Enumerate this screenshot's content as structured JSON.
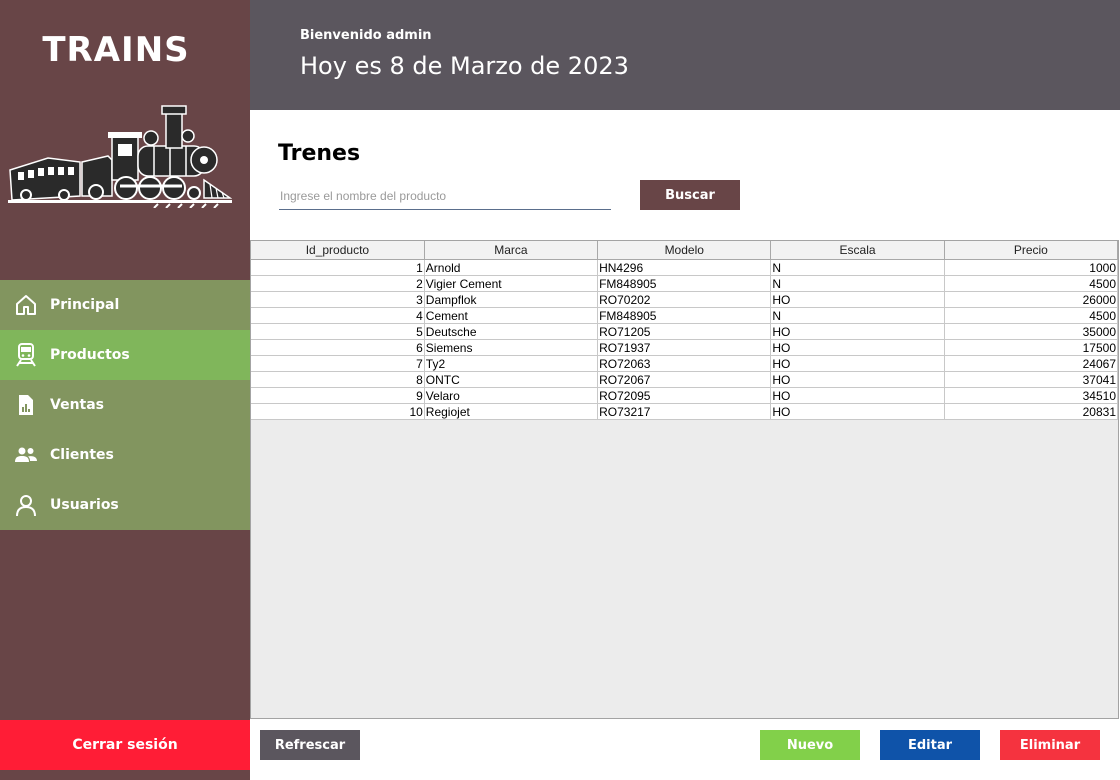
{
  "sidebar": {
    "app_title": "TRAINS",
    "items": [
      {
        "label": "Principal",
        "icon": "home-icon"
      },
      {
        "label": "Productos",
        "icon": "train-icon",
        "active": true
      },
      {
        "label": "Ventas",
        "icon": "report-icon"
      },
      {
        "label": "Clientes",
        "icon": "people-icon"
      },
      {
        "label": "Usuarios",
        "icon": "user-icon"
      }
    ],
    "logout_label": "Cerrar sesión"
  },
  "header": {
    "welcome": "Bienvenido admin",
    "date": "Hoy es 8 de Marzo de 2023"
  },
  "main": {
    "title": "Trenes",
    "search": {
      "placeholder": "Ingrese el nombre del producto",
      "value": "",
      "button_label": "Buscar"
    },
    "table": {
      "columns": [
        "Id_producto",
        "Marca",
        "Modelo",
        "Escala",
        "Precio"
      ],
      "rows": [
        [
          "1",
          "Arnold",
          "HN4296",
          "N",
          "1000"
        ],
        [
          "2",
          "Vigier Cement",
          "FM848905",
          "N",
          "4500"
        ],
        [
          "3",
          "Dampflok",
          "RO70202",
          "HO",
          "26000"
        ],
        [
          "4",
          "Cement",
          "FM848905",
          "N",
          "4500"
        ],
        [
          "5",
          "Deutsche",
          "RO71205",
          "HO",
          "35000"
        ],
        [
          "6",
          "Siemens",
          "RO71937",
          "HO",
          "17500"
        ],
        [
          "7",
          "Ty2",
          "RO72063",
          "HO",
          "24067"
        ],
        [
          "8",
          "ONTC",
          "RO72067",
          "HO",
          "37041"
        ],
        [
          "9",
          "Velaro",
          "RO72095",
          "HO",
          "34510"
        ],
        [
          "10",
          "Regiojet",
          "RO73217",
          "HO",
          "20831"
        ]
      ]
    }
  },
  "footer": {
    "refresh_label": "Refrescar",
    "new_label": "Nuevo",
    "edit_label": "Editar",
    "delete_label": "Eliminar"
  },
  "colors": {
    "sidebar": "#684547",
    "nav": "#82955f",
    "nav_active": "#80b65b",
    "header": "#5b565e",
    "logout": "#ff1d36",
    "refresh": "#5b565e",
    "new": "#82d04a",
    "edit": "#0f53a9",
    "delete": "#f5333f"
  }
}
